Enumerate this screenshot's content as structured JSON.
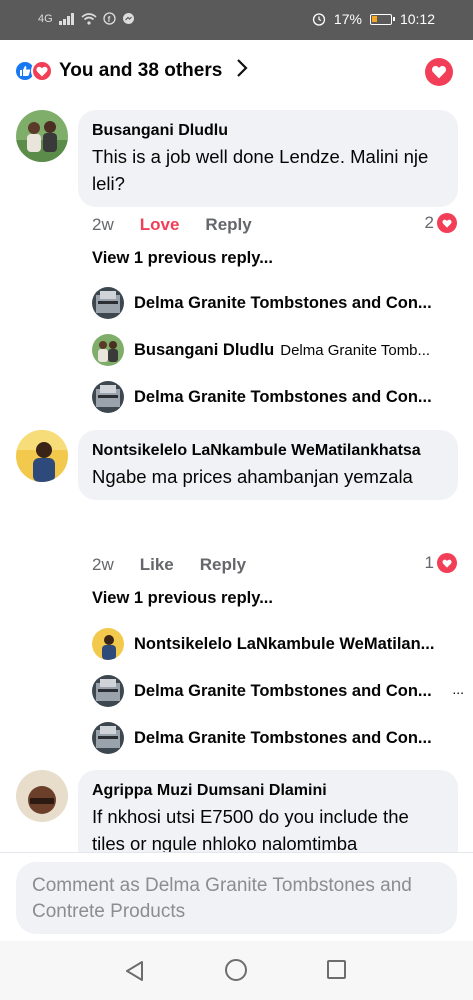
{
  "status_bar": {
    "signal": "4G",
    "battery": "17%",
    "time": "10:12"
  },
  "header": {
    "reactions_text": "You and 38 others"
  },
  "comments": [
    {
      "author": "Busangani Dludlu",
      "text": "This is a job well done Lendze. Malini nje leli?",
      "time": "2w",
      "react_label": "Love",
      "reply_label": "Reply",
      "reaction_count": "2",
      "view_previous": "View 1 previous reply...",
      "replies": [
        {
          "name": "Delma Granite Tombstones and  Con...",
          "text": ""
        },
        {
          "name": "Busangani Dludlu",
          "text": "Delma Granite Tomb..."
        },
        {
          "name": "Delma Granite Tombstones and  Con...",
          "text": ""
        }
      ]
    },
    {
      "author": "Nontsikelelo LaNkambule WeMatilankhatsa",
      "text": "Ngabe ma prices ahambanjan yemzala",
      "time": "2w",
      "react_label": "Like",
      "reply_label": "Reply",
      "reaction_count": "1",
      "view_previous": "View 1 previous reply...",
      "replies": [
        {
          "name": "Nontsikelelo LaNkambule WeMatilan...",
          "text": ""
        },
        {
          "name": "Delma Granite Tombstones and  Con...",
          "text": "..."
        },
        {
          "name": "Delma Granite Tombstones and  Con...",
          "text": ""
        }
      ]
    },
    {
      "author": "Agrippa Muzi Dumsani Dlamini",
      "text": "If nkhosi utsi E7500 do you include the tiles or ngule nhloko nalomtimba"
    }
  ],
  "composer": {
    "placeholder": "Comment as Delma Granite Tombstones and  Contrete Products"
  },
  "colors": {
    "accent_blue": "#1877f2",
    "love_red": "#f33e58",
    "bubble_gray": "#f0f2f5"
  }
}
